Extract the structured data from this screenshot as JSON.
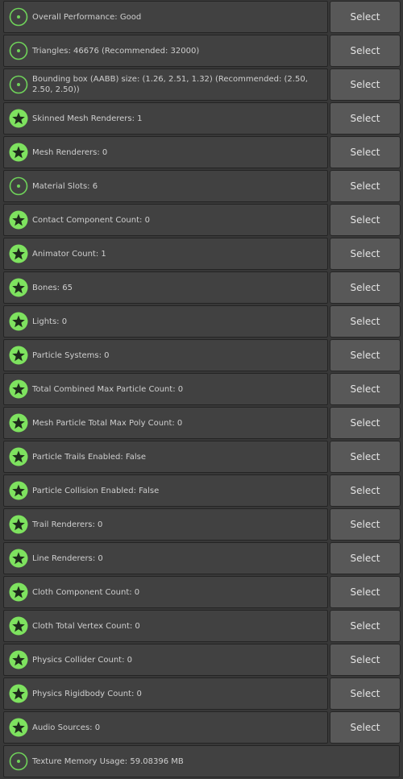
{
  "colors": {
    "status_good": "#6fd35a",
    "status_excellent": "#7ee25f",
    "row_background": "#414141",
    "button_background": "#585858",
    "page_background": "#383838"
  },
  "button_label": "Select",
  "rows": [
    {
      "label": "Overall Performance: Good",
      "icon": "good-rating-icon",
      "has_button": true
    },
    {
      "label": "Triangles: 46676 (Recommended: 32000)",
      "icon": "good-rating-icon",
      "has_button": true
    },
    {
      "label": "Bounding box (AABB) size: (1.26, 2.51, 1.32) (Recommended: (2.50, 2.50, 2.50))",
      "icon": "good-rating-icon",
      "has_button": true
    },
    {
      "label": "Skinned Mesh Renderers: 1",
      "icon": "excellent-rating-star-icon",
      "has_button": true
    },
    {
      "label": "Mesh Renderers: 0",
      "icon": "excellent-rating-star-icon",
      "has_button": true
    },
    {
      "label": "Material Slots: 6",
      "icon": "good-rating-icon",
      "has_button": true
    },
    {
      "label": "Contact Component Count: 0",
      "icon": "excellent-rating-star-icon",
      "has_button": true
    },
    {
      "label": "Animator Count: 1",
      "icon": "excellent-rating-star-icon",
      "has_button": true
    },
    {
      "label": "Bones: 65",
      "icon": "excellent-rating-star-icon",
      "has_button": true
    },
    {
      "label": "Lights: 0",
      "icon": "excellent-rating-star-icon",
      "has_button": true
    },
    {
      "label": "Particle Systems: 0",
      "icon": "excellent-rating-star-icon",
      "has_button": true
    },
    {
      "label": "Total Combined Max Particle Count: 0",
      "icon": "excellent-rating-star-icon",
      "has_button": true
    },
    {
      "label": "Mesh Particle Total Max Poly Count: 0",
      "icon": "excellent-rating-star-icon",
      "has_button": true
    },
    {
      "label": "Particle Trails Enabled: False",
      "icon": "excellent-rating-star-icon",
      "has_button": true
    },
    {
      "label": "Particle Collision Enabled: False",
      "icon": "excellent-rating-star-icon",
      "has_button": true
    },
    {
      "label": "Trail Renderers: 0",
      "icon": "excellent-rating-star-icon",
      "has_button": true
    },
    {
      "label": "Line Renderers: 0",
      "icon": "excellent-rating-star-icon",
      "has_button": true
    },
    {
      "label": "Cloth Component Count: 0",
      "icon": "excellent-rating-star-icon",
      "has_button": true
    },
    {
      "label": "Cloth Total Vertex Count: 0",
      "icon": "excellent-rating-star-icon",
      "has_button": true
    },
    {
      "label": "Physics Collider Count: 0",
      "icon": "excellent-rating-star-icon",
      "has_button": true
    },
    {
      "label": "Physics Rigidbody Count: 0",
      "icon": "excellent-rating-star-icon",
      "has_button": true
    },
    {
      "label": "Audio Sources: 0",
      "icon": "excellent-rating-star-icon",
      "has_button": true
    },
    {
      "label": "Texture Memory Usage: 59.08396 MB",
      "icon": "good-rating-icon",
      "has_button": false
    }
  ]
}
